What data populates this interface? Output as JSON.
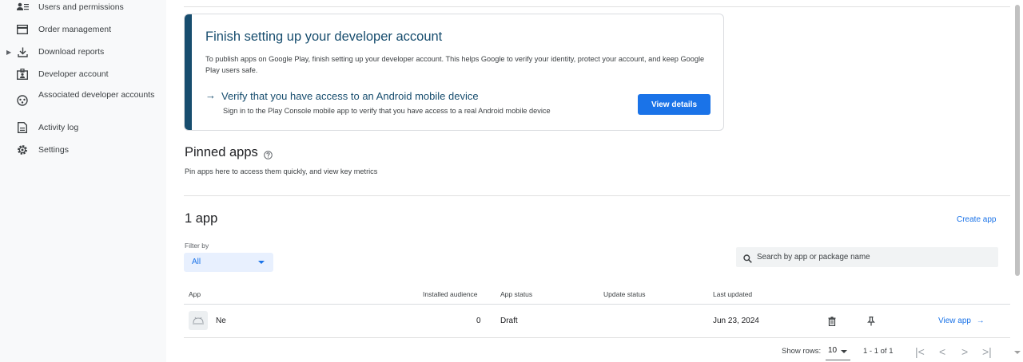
{
  "sidebar": {
    "items": [
      {
        "label": "Users and permissions",
        "icon": "users-icon",
        "caret": ""
      },
      {
        "label": "Order management",
        "icon": "credit-card-icon",
        "caret": ""
      },
      {
        "label": "Download reports",
        "icon": "download-icon",
        "caret": "▶"
      },
      {
        "label": "Developer account",
        "icon": "id-badge-icon",
        "caret": ""
      },
      {
        "label": "Associated developer accounts",
        "icon": "link-accounts-icon",
        "caret": ""
      },
      {
        "label": "Activity log",
        "icon": "document-icon",
        "caret": ""
      },
      {
        "label": "Settings",
        "icon": "gear-icon",
        "caret": ""
      }
    ]
  },
  "setup_card": {
    "title": "Finish setting up your developer account",
    "body": "To publish apps on Google Play, finish setting up your developer account. This helps Google to verify your identity, protect your account, and keep Google Play users safe.",
    "arrow": "→",
    "verify_title": "Verify that you have access to an Android mobile device",
    "verify_sub": "Sign in to the Play Console mobile app to verify that you have access to a real Android mobile device",
    "button": "View details",
    "accent_color": "#174d6e"
  },
  "pinned": {
    "title": "Pinned apps",
    "subtitle": "Pin apps here to access them quickly, and view key metrics"
  },
  "apps": {
    "count_title": "1 app",
    "create_link": "Create app",
    "filter_label": "Filter by",
    "filter_value": "All",
    "search_placeholder": "Search by app or package name",
    "columns": [
      "App",
      "Installed audience",
      "App status",
      "Update status",
      "Last updated"
    ],
    "rows": [
      {
        "name": "Ne",
        "installed": "0",
        "status": "Draft",
        "update_status": "",
        "last_updated": "Jun 23, 2024",
        "view": "View app",
        "view_arrow": "→"
      }
    ]
  },
  "pagination": {
    "show_rows_label": "Show rows:",
    "rows_value": "10",
    "range": "1 - 1 of 1",
    "first": "|<",
    "prev": "<",
    "next": ">",
    "last": ">|"
  },
  "colors": {
    "primary": "#1a73e8",
    "sidebar_bg": "#f8f9fa",
    "title_blue": "#174d6e"
  }
}
